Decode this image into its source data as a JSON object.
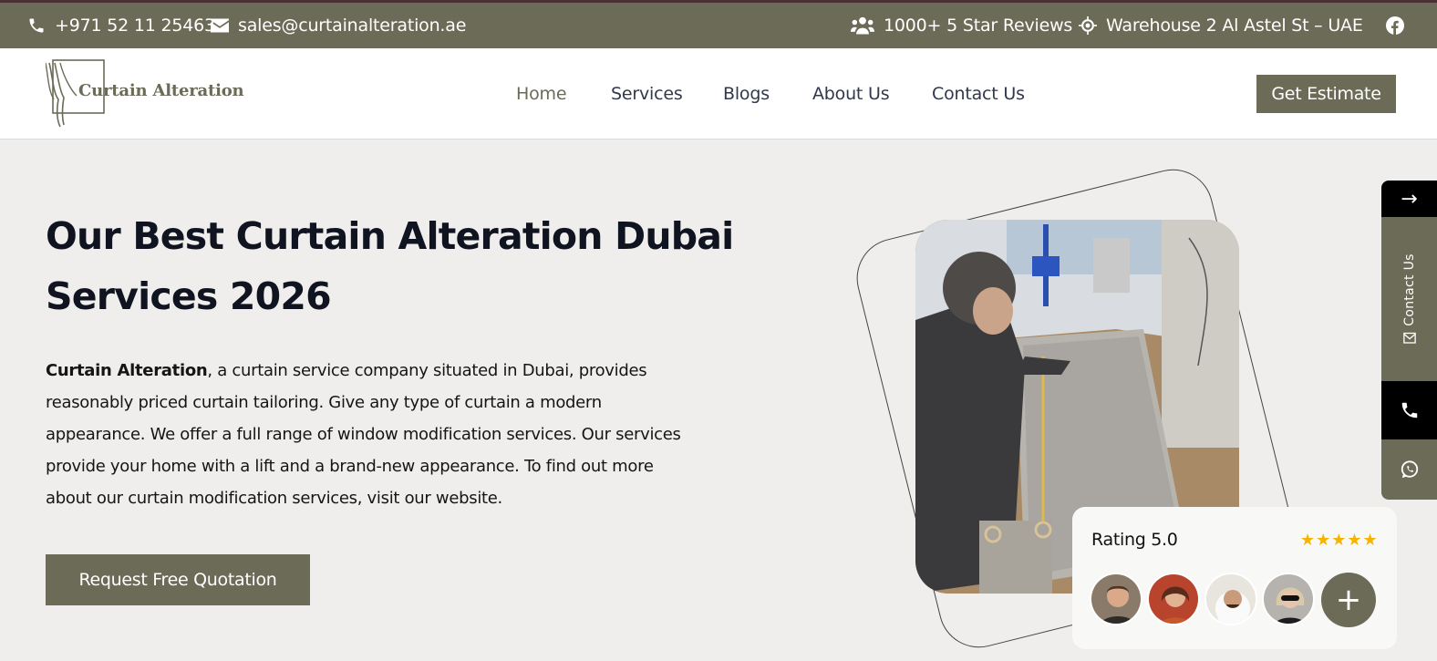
{
  "topbar": {
    "phone": "+971 52 11 25463",
    "email": "sales@curtainalteration.ae",
    "reviews": "1000+ 5 Star Reviews",
    "location": "Warehouse 2 Al Astel St – UAE",
    "icons": [
      "phone-icon",
      "mail-icon",
      "users-icon",
      "location-pin-icon",
      "facebook-icon"
    ]
  },
  "nav": {
    "logo_text": "Curtain Alteration",
    "links": [
      "Home",
      "Services",
      "Blogs",
      "About Us",
      "Contact Us"
    ],
    "active": "Home",
    "cta": "Get Estimate"
  },
  "hero": {
    "title": "Our Best Curtain Alteration Dubai Services 2026",
    "para_bold": "Curtain Alteration",
    "para_rest": ", a curtain service company situated in Dubai, provides reasonably priced curtain tailoring. Give any type of curtain a modern appearance. We offer a full range of window modification services. Our services provide your home with a lift and a brand-new appearance. To find out more about our curtain modification services, visit our website.",
    "cta": "Request Free Quotation"
  },
  "rating": {
    "label": "Rating 5.0",
    "stars": "★★★★★",
    "plus": "+"
  },
  "side": {
    "arrow": "→",
    "contact_label": "Contact Us"
  },
  "colors": {
    "brand_olive": "#6b6b57",
    "star_gold": "#f5b400",
    "topbar_border": "#4a2f33"
  }
}
